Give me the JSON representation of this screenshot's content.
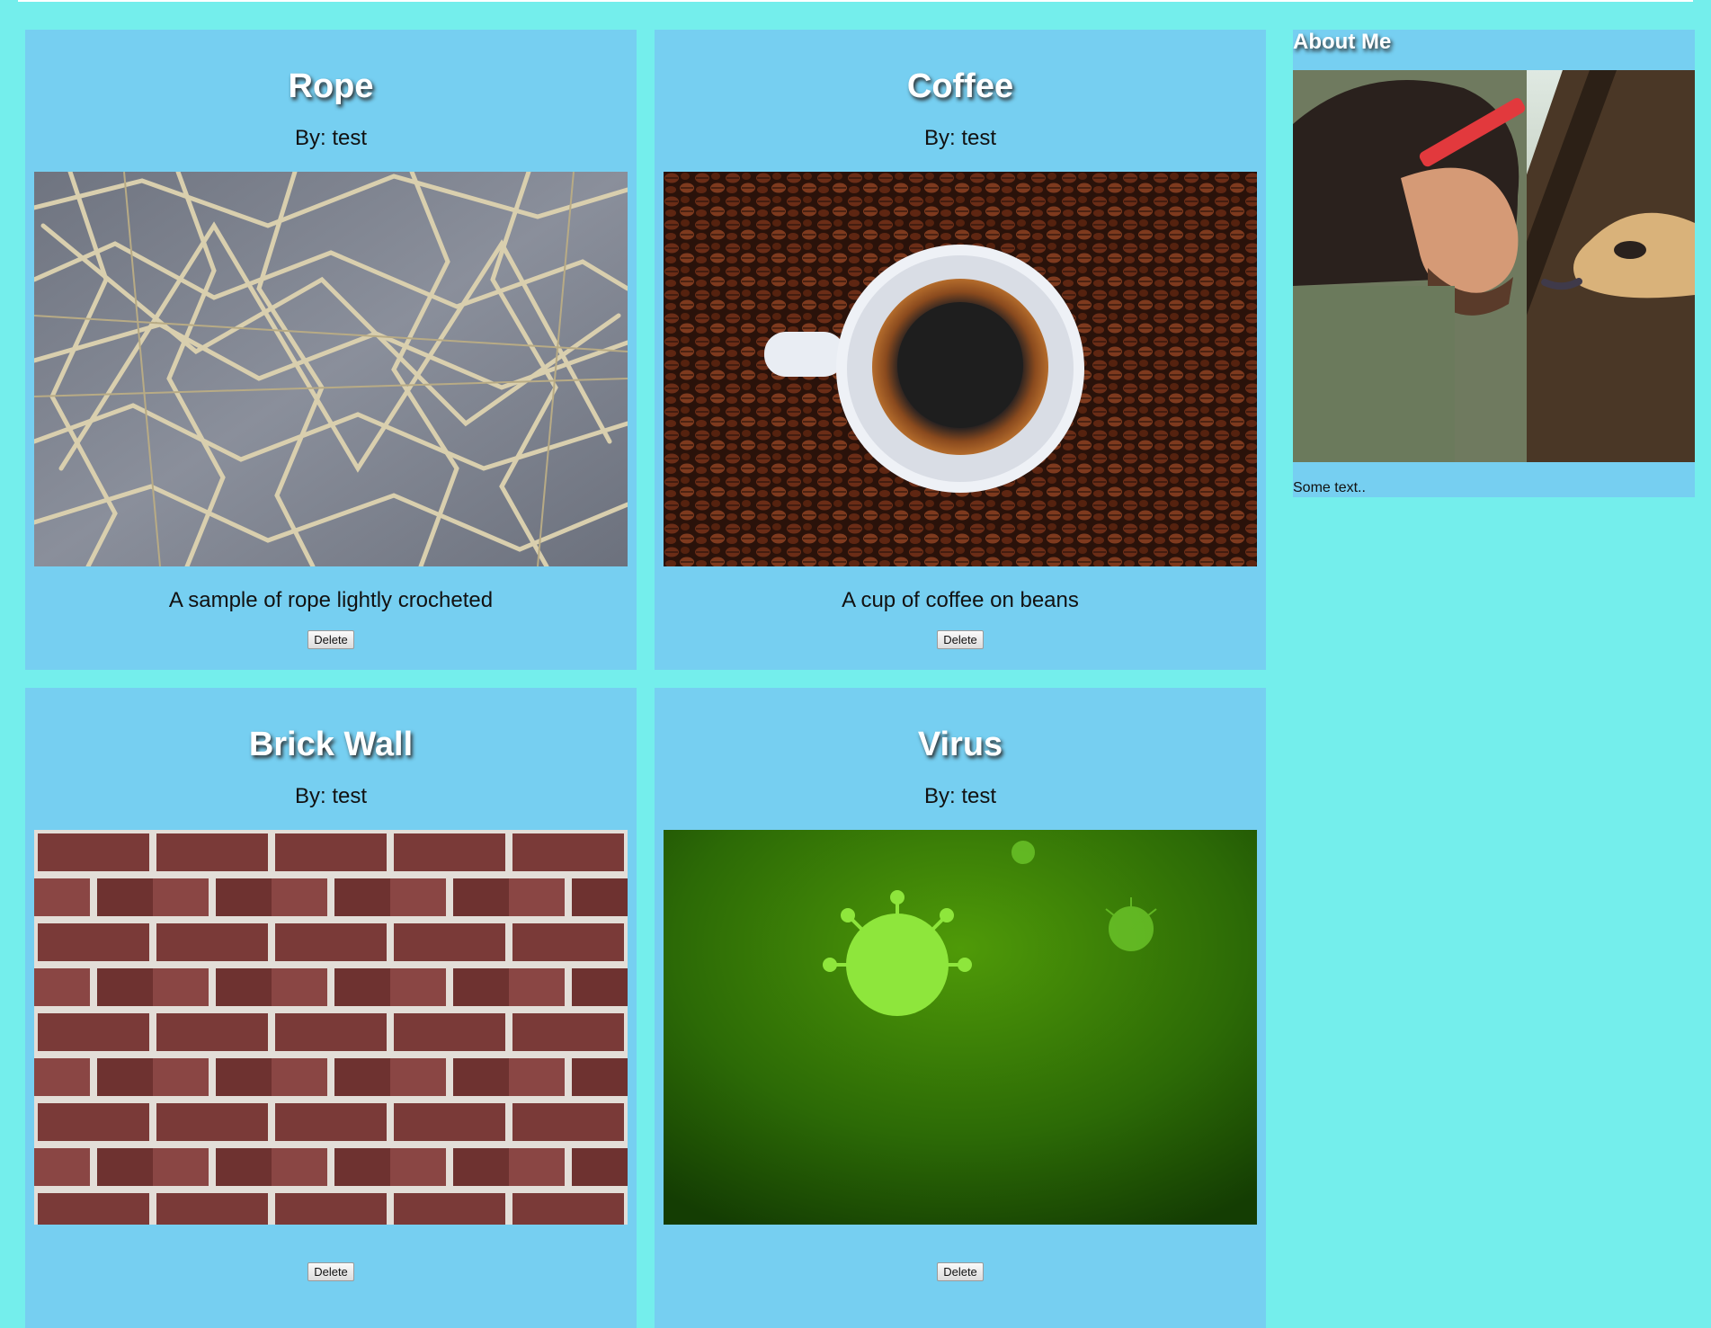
{
  "posts": [
    {
      "title": "Rope",
      "author": "By: test",
      "description": "A sample of rope lightly crocheted",
      "delete_label": "Delete",
      "image_icon": "rope-photo"
    },
    {
      "title": "Coffee",
      "author": "By: test",
      "description": "A cup of coffee on beans",
      "delete_label": "Delete",
      "image_icon": "coffee-photo"
    },
    {
      "title": "Brick Wall",
      "author": "By: test",
      "description": "",
      "delete_label": "Delete",
      "image_icon": "brick-wall-photo"
    },
    {
      "title": "Virus",
      "author": "By: test",
      "description": "",
      "delete_label": "Delete",
      "image_icon": "virus-photo"
    }
  ],
  "sidebar": {
    "heading": "About Me",
    "text": "Some text..",
    "image_icon": "profile-photo-with-giraffe"
  },
  "colors": {
    "page_background": "#74eeec",
    "card_background": "#76cff1",
    "heading_text": "#ffffff"
  }
}
